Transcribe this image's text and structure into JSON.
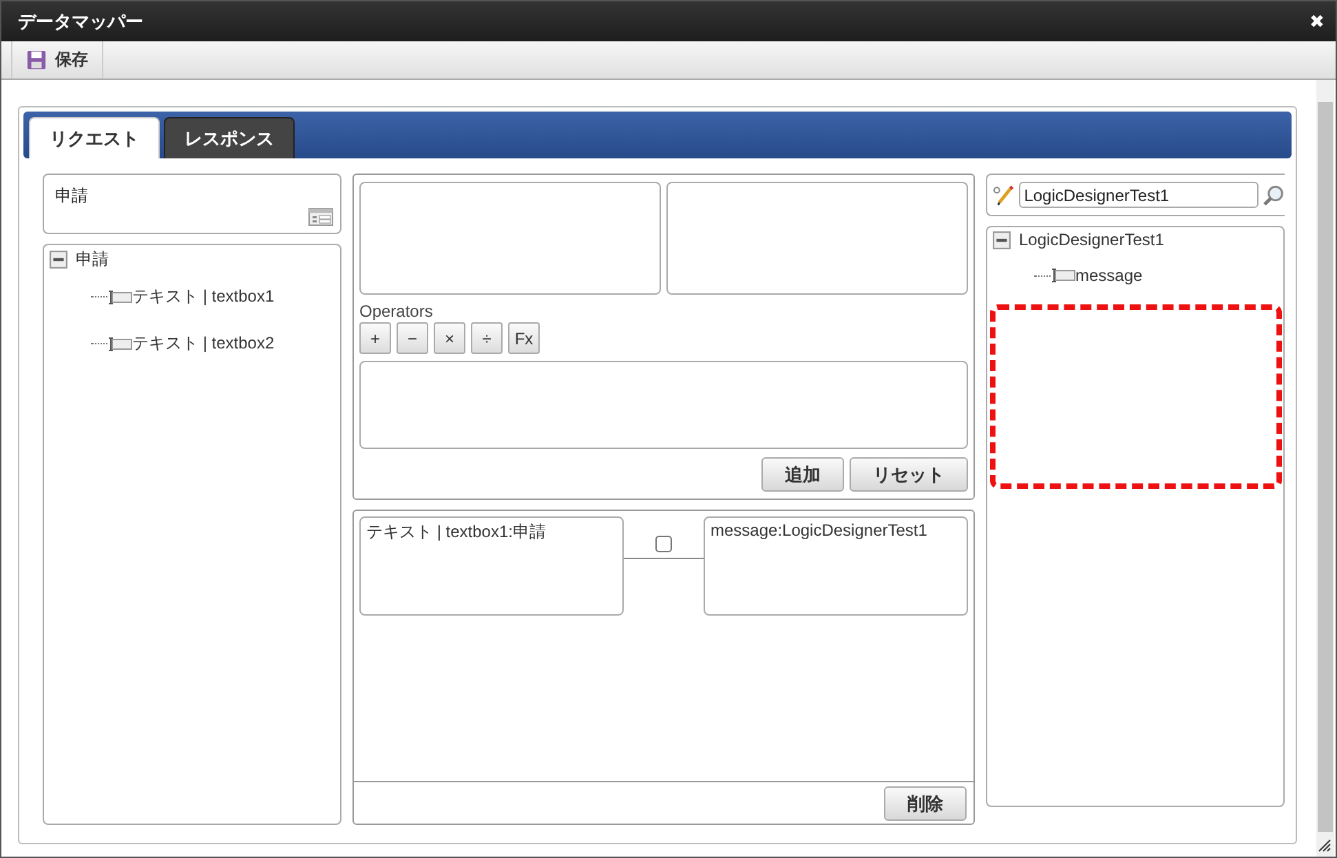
{
  "window": {
    "title": "データマッパー",
    "close": "✖"
  },
  "toolbar": [
    {
      "label": "保存"
    }
  ],
  "tabs": [
    {
      "label": "リクエスト",
      "selected": true
    },
    {
      "label": "レスポンス",
      "selected": false
    }
  ],
  "source": {
    "header": "申請",
    "tree": [
      {
        "label": "申請",
        "expanded": true,
        "children": [
          {
            "label": "テキスト | textbox1"
          },
          {
            "label": "テキスト | textbox2"
          }
        ]
      }
    ]
  },
  "editor": {
    "operators_label": "Operators",
    "operators": [
      "+",
      "−",
      "×",
      "÷",
      "Fx"
    ],
    "buttons": [
      "追加",
      "リセット"
    ]
  },
  "mapping": {
    "rows": [
      {
        "source": "テキスト | textbox1:申請",
        "target": "message:LogicDesignerTest1",
        "checked": false
      }
    ],
    "buttons": [
      "削除"
    ]
  },
  "target": {
    "search": {
      "value": "LogicDesignerTest1"
    },
    "tree": [
      {
        "label": "LogicDesignerTest1",
        "expanded": true,
        "children": [
          {
            "label": "message"
          }
        ]
      }
    ]
  }
}
